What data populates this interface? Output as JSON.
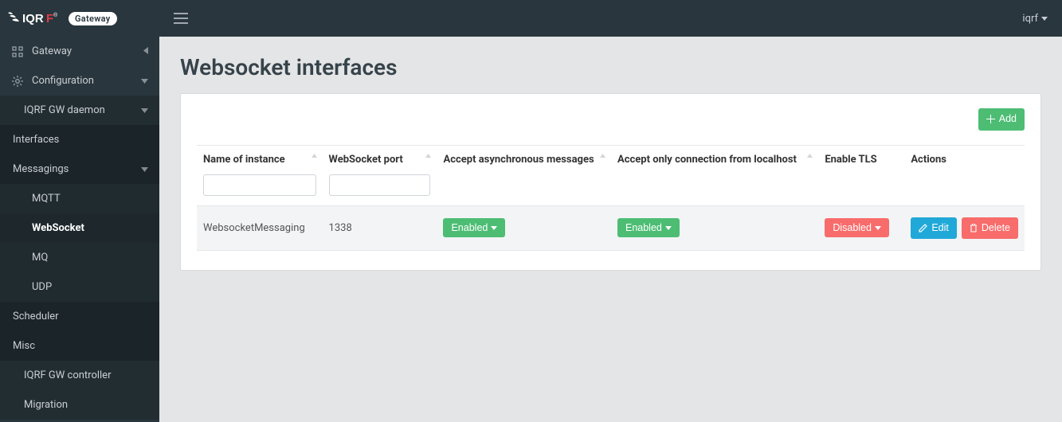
{
  "brand": {
    "badge": "Gateway"
  },
  "header": {
    "user_label": "iqrf"
  },
  "sidebar": {
    "items": [
      {
        "label": "Gateway",
        "icon": "grid",
        "level": 0,
        "caret": "left",
        "style": "base"
      },
      {
        "label": "Configuration",
        "icon": "gear",
        "level": 0,
        "caret": "down",
        "style": "base"
      },
      {
        "label": "IQRF GW daemon",
        "icon": "",
        "level": 1,
        "caret": "down",
        "style": "dark"
      },
      {
        "label": "Interfaces",
        "icon": "",
        "level": 2,
        "caret": "",
        "style": "darker"
      },
      {
        "label": "Messagings",
        "icon": "",
        "level": 2,
        "caret": "down",
        "style": "darker"
      },
      {
        "label": "MQTT",
        "icon": "",
        "level": 3,
        "caret": "",
        "style": "dark2"
      },
      {
        "label": "WebSocket",
        "icon": "",
        "level": 3,
        "caret": "",
        "style": "active-dark"
      },
      {
        "label": "MQ",
        "icon": "",
        "level": 3,
        "caret": "",
        "style": "dark2"
      },
      {
        "label": "UDP",
        "icon": "",
        "level": 3,
        "caret": "",
        "style": "dark2"
      },
      {
        "label": "Scheduler",
        "icon": "",
        "level": 2,
        "caret": "",
        "style": "darker"
      },
      {
        "label": "Misc",
        "icon": "",
        "level": 2,
        "caret": "",
        "style": "darker"
      },
      {
        "label": "IQRF GW controller",
        "icon": "",
        "level": 1,
        "caret": "",
        "style": "dark"
      },
      {
        "label": "Migration",
        "icon": "",
        "level": 1,
        "caret": "",
        "style": "dark"
      }
    ]
  },
  "page": {
    "title": "Websocket interfaces",
    "add_label": "Add",
    "columns": [
      "Name of instance",
      "WebSocket port",
      "Accept asynchronous messages",
      "Accept only connection from localhost",
      "Enable TLS",
      "Actions"
    ],
    "row": {
      "name": "WebsocketMessaging",
      "port": "1338",
      "async_label": "Enabled",
      "localhost_label": "Enabled",
      "tls_label": "Disabled",
      "edit_label": "Edit",
      "delete_label": "Delete"
    }
  }
}
